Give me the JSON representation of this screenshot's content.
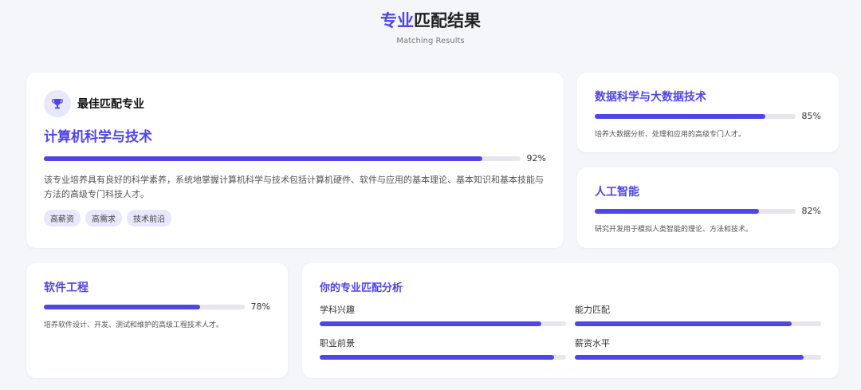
{
  "header": {
    "title_highlight": "专业",
    "title_rest": "匹配结果",
    "subtitle": "Matching Results"
  },
  "best": {
    "label": "最佳匹配专业",
    "icon": "trophy-icon",
    "name": "计算机科学与技术",
    "percent_label": "92%",
    "percent": 92,
    "description": "该专业培养具有良好的科学素养，系统地掌握计算机科学与技术包括计算机硬件、软件与应用的基本理论、基本知识和基本技能与方法的高级专门科技人才。",
    "tags": [
      "高薪资",
      "高需求",
      "技术前沿"
    ]
  },
  "others": [
    {
      "name": "数据科学与大数据技术",
      "percent_label": "85%",
      "percent": 85,
      "description": "培养大数据分析、处理和应用的高级专门人才。"
    },
    {
      "name": "人工智能",
      "percent_label": "82%",
      "percent": 82,
      "description": "研究开发用于模拟人类智能的理论、方法和技术。"
    },
    {
      "name": "软件工程",
      "percent_label": "78%",
      "percent": 78,
      "description": "培养软件设计、开发、测试和维护的高级工程技术人才。"
    }
  ],
  "analysis": {
    "title": "你的专业匹配分析",
    "metrics": [
      {
        "label": "学科兴趣",
        "percent": 90
      },
      {
        "label": "能力匹配",
        "percent": 88
      },
      {
        "label": "职业前景",
        "percent": 95
      },
      {
        "label": "薪资水平",
        "percent": 93
      }
    ]
  },
  "colors": {
    "accent": "#4f46e5",
    "track": "#e6e6ec",
    "tag_bg": "#e8e7fb"
  }
}
